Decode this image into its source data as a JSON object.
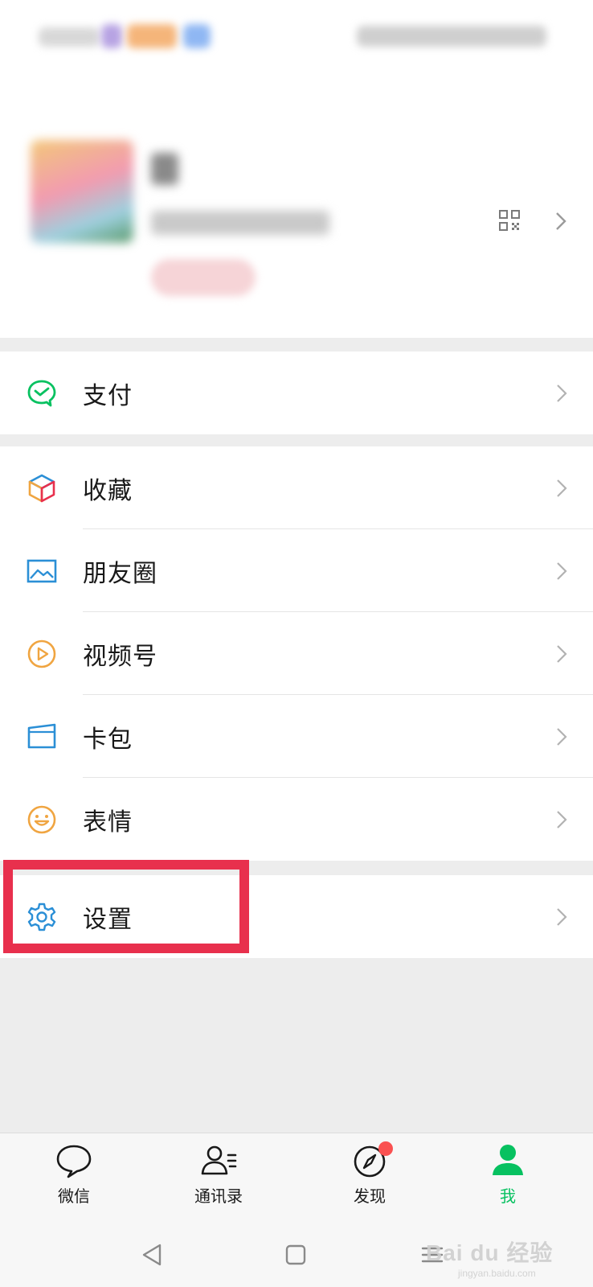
{
  "profile": {
    "qr_icon": "qr-code-icon",
    "chevron_icon": "chevron-right-icon"
  },
  "menu": {
    "pay": {
      "label": "支付",
      "icon": "pay-icon",
      "color": "#07c160"
    },
    "favorites": {
      "label": "收藏",
      "icon": "favorites-cube-icon"
    },
    "moments": {
      "label": "朋友圈",
      "icon": "moments-picture-icon",
      "color": "#2b8fd6"
    },
    "channels": {
      "label": "视频号",
      "icon": "channels-play-icon",
      "color": "#f0a541"
    },
    "cards": {
      "label": "卡包",
      "icon": "card-wallet-icon",
      "color": "#2b8fd6"
    },
    "stickers": {
      "label": "表情",
      "icon": "sticker-smile-icon",
      "color": "#f0a541"
    },
    "settings": {
      "label": "设置",
      "icon": "gear-icon",
      "color": "#2b8fd6"
    }
  },
  "annotation": {
    "highlight_color": "#e8304d"
  },
  "tabbar": {
    "tabs": [
      {
        "label": "微信",
        "icon": "chat-bubble-icon",
        "active": false
      },
      {
        "label": "通讯录",
        "icon": "contacts-icon",
        "active": false
      },
      {
        "label": "发现",
        "icon": "compass-icon",
        "active": false,
        "badge": true
      },
      {
        "label": "我",
        "icon": "person-icon",
        "active": true
      }
    ],
    "active_color": "#07c160",
    "badge_color": "#fa5151"
  },
  "system_nav": {
    "back": "back-triangle-icon",
    "home": "home-square-icon",
    "menu": "menu-lines-icon"
  },
  "watermark": {
    "main": "Bai du 经验",
    "sub": "jingyan.baidu.com"
  }
}
